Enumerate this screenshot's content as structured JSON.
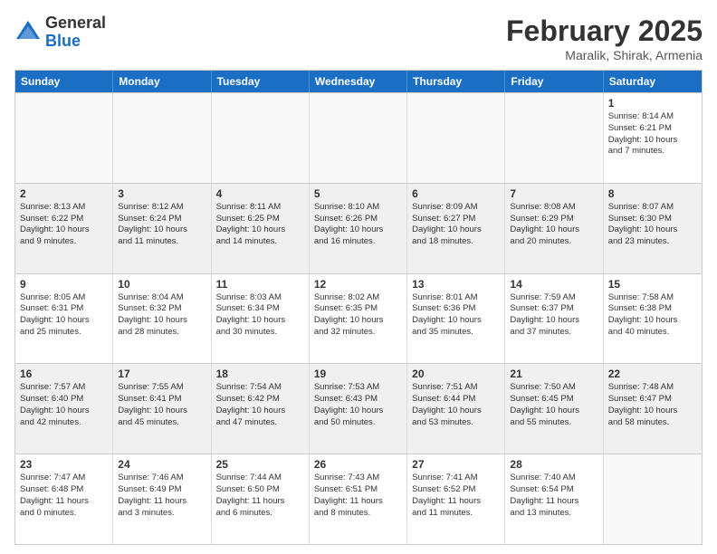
{
  "header": {
    "logo_general": "General",
    "logo_blue": "Blue",
    "title": "February 2025",
    "subtitle": "Maralik, Shirak, Armenia"
  },
  "days_of_week": [
    "Sunday",
    "Monday",
    "Tuesday",
    "Wednesday",
    "Thursday",
    "Friday",
    "Saturday"
  ],
  "weeks": [
    [
      {
        "day": "",
        "info": "",
        "empty": true
      },
      {
        "day": "",
        "info": "",
        "empty": true
      },
      {
        "day": "",
        "info": "",
        "empty": true
      },
      {
        "day": "",
        "info": "",
        "empty": true
      },
      {
        "day": "",
        "info": "",
        "empty": true
      },
      {
        "day": "",
        "info": "",
        "empty": true
      },
      {
        "day": "1",
        "info": "Sunrise: 8:14 AM\nSunset: 6:21 PM\nDaylight: 10 hours\nand 7 minutes.",
        "empty": false
      }
    ],
    [
      {
        "day": "2",
        "info": "Sunrise: 8:13 AM\nSunset: 6:22 PM\nDaylight: 10 hours\nand 9 minutes.",
        "empty": false
      },
      {
        "day": "3",
        "info": "Sunrise: 8:12 AM\nSunset: 6:24 PM\nDaylight: 10 hours\nand 11 minutes.",
        "empty": false
      },
      {
        "day": "4",
        "info": "Sunrise: 8:11 AM\nSunset: 6:25 PM\nDaylight: 10 hours\nand 14 minutes.",
        "empty": false
      },
      {
        "day": "5",
        "info": "Sunrise: 8:10 AM\nSunset: 6:26 PM\nDaylight: 10 hours\nand 16 minutes.",
        "empty": false
      },
      {
        "day": "6",
        "info": "Sunrise: 8:09 AM\nSunset: 6:27 PM\nDaylight: 10 hours\nand 18 minutes.",
        "empty": false
      },
      {
        "day": "7",
        "info": "Sunrise: 8:08 AM\nSunset: 6:29 PM\nDaylight: 10 hours\nand 20 minutes.",
        "empty": false
      },
      {
        "day": "8",
        "info": "Sunrise: 8:07 AM\nSunset: 6:30 PM\nDaylight: 10 hours\nand 23 minutes.",
        "empty": false
      }
    ],
    [
      {
        "day": "9",
        "info": "Sunrise: 8:05 AM\nSunset: 6:31 PM\nDaylight: 10 hours\nand 25 minutes.",
        "empty": false
      },
      {
        "day": "10",
        "info": "Sunrise: 8:04 AM\nSunset: 6:32 PM\nDaylight: 10 hours\nand 28 minutes.",
        "empty": false
      },
      {
        "day": "11",
        "info": "Sunrise: 8:03 AM\nSunset: 6:34 PM\nDaylight: 10 hours\nand 30 minutes.",
        "empty": false
      },
      {
        "day": "12",
        "info": "Sunrise: 8:02 AM\nSunset: 6:35 PM\nDaylight: 10 hours\nand 32 minutes.",
        "empty": false
      },
      {
        "day": "13",
        "info": "Sunrise: 8:01 AM\nSunset: 6:36 PM\nDaylight: 10 hours\nand 35 minutes.",
        "empty": false
      },
      {
        "day": "14",
        "info": "Sunrise: 7:59 AM\nSunset: 6:37 PM\nDaylight: 10 hours\nand 37 minutes.",
        "empty": false
      },
      {
        "day": "15",
        "info": "Sunrise: 7:58 AM\nSunset: 6:38 PM\nDaylight: 10 hours\nand 40 minutes.",
        "empty": false
      }
    ],
    [
      {
        "day": "16",
        "info": "Sunrise: 7:57 AM\nSunset: 6:40 PM\nDaylight: 10 hours\nand 42 minutes.",
        "empty": false
      },
      {
        "day": "17",
        "info": "Sunrise: 7:55 AM\nSunset: 6:41 PM\nDaylight: 10 hours\nand 45 minutes.",
        "empty": false
      },
      {
        "day": "18",
        "info": "Sunrise: 7:54 AM\nSunset: 6:42 PM\nDaylight: 10 hours\nand 47 minutes.",
        "empty": false
      },
      {
        "day": "19",
        "info": "Sunrise: 7:53 AM\nSunset: 6:43 PM\nDaylight: 10 hours\nand 50 minutes.",
        "empty": false
      },
      {
        "day": "20",
        "info": "Sunrise: 7:51 AM\nSunset: 6:44 PM\nDaylight: 10 hours\nand 53 minutes.",
        "empty": false
      },
      {
        "day": "21",
        "info": "Sunrise: 7:50 AM\nSunset: 6:45 PM\nDaylight: 10 hours\nand 55 minutes.",
        "empty": false
      },
      {
        "day": "22",
        "info": "Sunrise: 7:48 AM\nSunset: 6:47 PM\nDaylight: 10 hours\nand 58 minutes.",
        "empty": false
      }
    ],
    [
      {
        "day": "23",
        "info": "Sunrise: 7:47 AM\nSunset: 6:48 PM\nDaylight: 11 hours\nand 0 minutes.",
        "empty": false
      },
      {
        "day": "24",
        "info": "Sunrise: 7:46 AM\nSunset: 6:49 PM\nDaylight: 11 hours\nand 3 minutes.",
        "empty": false
      },
      {
        "day": "25",
        "info": "Sunrise: 7:44 AM\nSunset: 6:50 PM\nDaylight: 11 hours\nand 6 minutes.",
        "empty": false
      },
      {
        "day": "26",
        "info": "Sunrise: 7:43 AM\nSunset: 6:51 PM\nDaylight: 11 hours\nand 8 minutes.",
        "empty": false
      },
      {
        "day": "27",
        "info": "Sunrise: 7:41 AM\nSunset: 6:52 PM\nDaylight: 11 hours\nand 11 minutes.",
        "empty": false
      },
      {
        "day": "28",
        "info": "Sunrise: 7:40 AM\nSunset: 6:54 PM\nDaylight: 11 hours\nand 13 minutes.",
        "empty": false
      },
      {
        "day": "",
        "info": "",
        "empty": true
      }
    ]
  ]
}
